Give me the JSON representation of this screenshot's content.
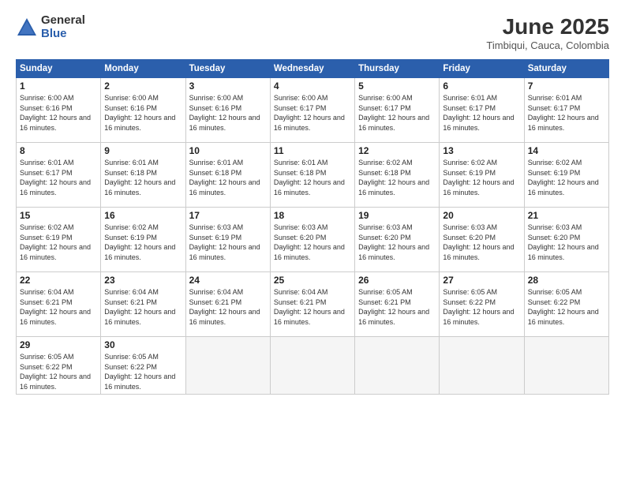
{
  "logo": {
    "general": "General",
    "blue": "Blue"
  },
  "title": "June 2025",
  "location": "Timbiqui, Cauca, Colombia",
  "headers": [
    "Sunday",
    "Monday",
    "Tuesday",
    "Wednesday",
    "Thursday",
    "Friday",
    "Saturday"
  ],
  "weeks": [
    [
      {
        "day": "1",
        "sunrise": "Sunrise: 6:00 AM",
        "sunset": "Sunset: 6:16 PM",
        "daylight": "Daylight: 12 hours and 16 minutes."
      },
      {
        "day": "2",
        "sunrise": "Sunrise: 6:00 AM",
        "sunset": "Sunset: 6:16 PM",
        "daylight": "Daylight: 12 hours and 16 minutes."
      },
      {
        "day": "3",
        "sunrise": "Sunrise: 6:00 AM",
        "sunset": "Sunset: 6:16 PM",
        "daylight": "Daylight: 12 hours and 16 minutes."
      },
      {
        "day": "4",
        "sunrise": "Sunrise: 6:00 AM",
        "sunset": "Sunset: 6:17 PM",
        "daylight": "Daylight: 12 hours and 16 minutes."
      },
      {
        "day": "5",
        "sunrise": "Sunrise: 6:00 AM",
        "sunset": "Sunset: 6:17 PM",
        "daylight": "Daylight: 12 hours and 16 minutes."
      },
      {
        "day": "6",
        "sunrise": "Sunrise: 6:01 AM",
        "sunset": "Sunset: 6:17 PM",
        "daylight": "Daylight: 12 hours and 16 minutes."
      },
      {
        "day": "7",
        "sunrise": "Sunrise: 6:01 AM",
        "sunset": "Sunset: 6:17 PM",
        "daylight": "Daylight: 12 hours and 16 minutes."
      }
    ],
    [
      {
        "day": "8",
        "sunrise": "Sunrise: 6:01 AM",
        "sunset": "Sunset: 6:17 PM",
        "daylight": "Daylight: 12 hours and 16 minutes."
      },
      {
        "day": "9",
        "sunrise": "Sunrise: 6:01 AM",
        "sunset": "Sunset: 6:18 PM",
        "daylight": "Daylight: 12 hours and 16 minutes."
      },
      {
        "day": "10",
        "sunrise": "Sunrise: 6:01 AM",
        "sunset": "Sunset: 6:18 PM",
        "daylight": "Daylight: 12 hours and 16 minutes."
      },
      {
        "day": "11",
        "sunrise": "Sunrise: 6:01 AM",
        "sunset": "Sunset: 6:18 PM",
        "daylight": "Daylight: 12 hours and 16 minutes."
      },
      {
        "day": "12",
        "sunrise": "Sunrise: 6:02 AM",
        "sunset": "Sunset: 6:18 PM",
        "daylight": "Daylight: 12 hours and 16 minutes."
      },
      {
        "day": "13",
        "sunrise": "Sunrise: 6:02 AM",
        "sunset": "Sunset: 6:19 PM",
        "daylight": "Daylight: 12 hours and 16 minutes."
      },
      {
        "day": "14",
        "sunrise": "Sunrise: 6:02 AM",
        "sunset": "Sunset: 6:19 PM",
        "daylight": "Daylight: 12 hours and 16 minutes."
      }
    ],
    [
      {
        "day": "15",
        "sunrise": "Sunrise: 6:02 AM",
        "sunset": "Sunset: 6:19 PM",
        "daylight": "Daylight: 12 hours and 16 minutes."
      },
      {
        "day": "16",
        "sunrise": "Sunrise: 6:02 AM",
        "sunset": "Sunset: 6:19 PM",
        "daylight": "Daylight: 12 hours and 16 minutes."
      },
      {
        "day": "17",
        "sunrise": "Sunrise: 6:03 AM",
        "sunset": "Sunset: 6:19 PM",
        "daylight": "Daylight: 12 hours and 16 minutes."
      },
      {
        "day": "18",
        "sunrise": "Sunrise: 6:03 AM",
        "sunset": "Sunset: 6:20 PM",
        "daylight": "Daylight: 12 hours and 16 minutes."
      },
      {
        "day": "19",
        "sunrise": "Sunrise: 6:03 AM",
        "sunset": "Sunset: 6:20 PM",
        "daylight": "Daylight: 12 hours and 16 minutes."
      },
      {
        "day": "20",
        "sunrise": "Sunrise: 6:03 AM",
        "sunset": "Sunset: 6:20 PM",
        "daylight": "Daylight: 12 hours and 16 minutes."
      },
      {
        "day": "21",
        "sunrise": "Sunrise: 6:03 AM",
        "sunset": "Sunset: 6:20 PM",
        "daylight": "Daylight: 12 hours and 16 minutes."
      }
    ],
    [
      {
        "day": "22",
        "sunrise": "Sunrise: 6:04 AM",
        "sunset": "Sunset: 6:21 PM",
        "daylight": "Daylight: 12 hours and 16 minutes."
      },
      {
        "day": "23",
        "sunrise": "Sunrise: 6:04 AM",
        "sunset": "Sunset: 6:21 PM",
        "daylight": "Daylight: 12 hours and 16 minutes."
      },
      {
        "day": "24",
        "sunrise": "Sunrise: 6:04 AM",
        "sunset": "Sunset: 6:21 PM",
        "daylight": "Daylight: 12 hours and 16 minutes."
      },
      {
        "day": "25",
        "sunrise": "Sunrise: 6:04 AM",
        "sunset": "Sunset: 6:21 PM",
        "daylight": "Daylight: 12 hours and 16 minutes."
      },
      {
        "day": "26",
        "sunrise": "Sunrise: 6:05 AM",
        "sunset": "Sunset: 6:21 PM",
        "daylight": "Daylight: 12 hours and 16 minutes."
      },
      {
        "day": "27",
        "sunrise": "Sunrise: 6:05 AM",
        "sunset": "Sunset: 6:22 PM",
        "daylight": "Daylight: 12 hours and 16 minutes."
      },
      {
        "day": "28",
        "sunrise": "Sunrise: 6:05 AM",
        "sunset": "Sunset: 6:22 PM",
        "daylight": "Daylight: 12 hours and 16 minutes."
      }
    ],
    [
      {
        "day": "29",
        "sunrise": "Sunrise: 6:05 AM",
        "sunset": "Sunset: 6:22 PM",
        "daylight": "Daylight: 12 hours and 16 minutes."
      },
      {
        "day": "30",
        "sunrise": "Sunrise: 6:05 AM",
        "sunset": "Sunset: 6:22 PM",
        "daylight": "Daylight: 12 hours and 16 minutes."
      },
      null,
      null,
      null,
      null,
      null
    ]
  ]
}
